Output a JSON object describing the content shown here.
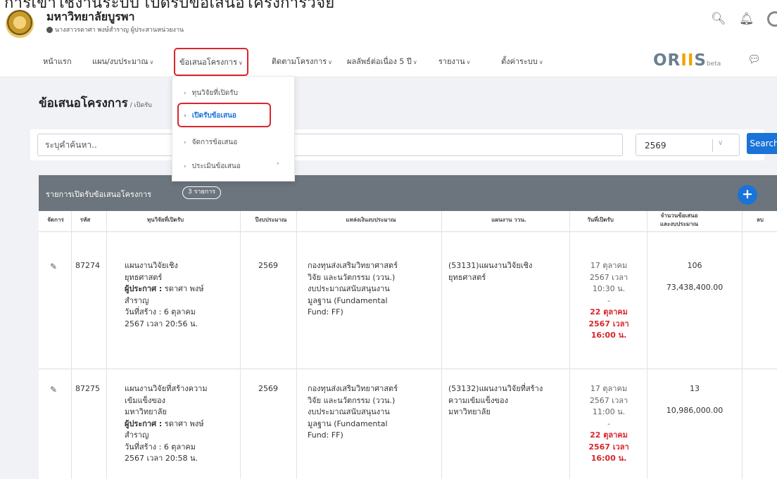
{
  "top_cut_text": "การเข้าใช้งานระบบ เปิดรับข้อเสนอโครงการวิจัย",
  "header": {
    "university": "มหาวิทยาลัยบูรพา",
    "user": "นางสาวรดาศา พงษ์สำราญ ผู้ประสานหน่วยงาน"
  },
  "nav": {
    "home": "หน้าแรก",
    "budget": "แผน/งบประมาณ",
    "proposal": "ข้อเสนอโครงการ",
    "tracking": "ติดตามโครงการ",
    "outcome": "ผลลัพธ์ต่อเนื่อง 5 ปี",
    "report": "รายงาน",
    "settings": "ตั้งค่าระบบ",
    "brand_main": "OR",
    "brand_ii": "II",
    "brand_s": "S",
    "brand_beta": "beta"
  },
  "dropdown": {
    "items": [
      "ทุนวิจัยที่เปิดรับ",
      "เปิดรับข้อเสนอ",
      "จัดการข้อเสนอ",
      "ประเมินข้อเสนอ"
    ]
  },
  "page": {
    "title": "ข้อเสนอโครงการ",
    "crumb": "/ เปิดรับ"
  },
  "search": {
    "placeholder": "ระบุคำค้นหา..",
    "year": "2569",
    "button": "Search"
  },
  "card": {
    "title": "รายการเปิดรับข้อเสนอโครงการ",
    "badge": "3 รายการ"
  },
  "table": {
    "headers": [
      "จัดการ",
      "รหัส",
      "ทุนวิจัยที่เปิดรับ",
      "ปีงบประมาณ",
      "แหล่งเงินงบประมาณ",
      "แผนงาน ววน.",
      "วันที่เปิดรับ",
      "จำนวนข้อเสนอ",
      "และงบประมาณ",
      "ลบ"
    ],
    "rows": [
      {
        "code": "87274",
        "fund_l1": "แผนงานวิจัยเชิง",
        "fund_l2": "ยุทธศาสตร์",
        "announcer_label": "ผู้ประกาศ :",
        "announcer_l1": " รดาศา พงษ์",
        "announcer_l2": "สำราญ",
        "created_l1": "วันที่สร้าง : 6 ตุลาคม",
        "created_l2": "2567 เวลา 20:56 น.",
        "year": "2569",
        "source_l1": "กองทุนส่งเสริมวิทยาศาสตร์",
        "source_l2": "วิจัย และนวัตกรรม (ววน.)",
        "source_l3": "งบประมาณสนับสนุนงาน",
        "source_l4": "มูลฐาน (Fundamental",
        "source_l5": "Fund: FF)",
        "plan_l1": "(53131)แผนงานวิจัยเชิง",
        "plan_l2": "ยุทธศาสตร์",
        "open_l1": "17 ตุลาคม",
        "open_l2": "2567 เวลา",
        "open_l3": "10:30 น.",
        "dash": "-",
        "close_l1": "22 ตุลาคม",
        "close_l2": "2567 เวลา",
        "close_l3": "16:00 น.",
        "count": "106",
        "amount": "73,438,400.00"
      },
      {
        "code": "87275",
        "fund_l1": "แผนงานวิจัยที่สร้างความ",
        "fund_l2": "เข้มแข็งของ",
        "fund_l3": "มหาวิทยาลัย",
        "announcer_label": "ผู้ประกาศ :",
        "announcer_l1": " รดาศา พงษ์",
        "announcer_l2": "สำราญ",
        "created_l1": "วันที่สร้าง : 6 ตุลาคม",
        "created_l2": "2567 เวลา 20:58 น.",
        "year": "2569",
        "source_l1": "กองทุนส่งเสริมวิทยาศาสตร์",
        "source_l2": "วิจัย และนวัตกรรม (ววน.)",
        "source_l3": "งบประมาณสนับสนุนงาน",
        "source_l4": "มูลฐาน (Fundamental",
        "source_l5": "Fund: FF)",
        "plan_l1": "(53132)แผนงานวิจัยที่สร้าง",
        "plan_l2": "ความเข้มแข็งของ",
        "plan_l3": "มหาวิทยาลัย",
        "open_l1": "17 ตุลาคม",
        "open_l2": "2567 เวลา",
        "open_l3": "11:00 น.",
        "dash": "-",
        "close_l1": "22 ตุลาคม",
        "close_l2": "2567 เวลา",
        "close_l3": "16:00 น.",
        "count": "13",
        "amount": "10,986,000.00"
      }
    ]
  }
}
